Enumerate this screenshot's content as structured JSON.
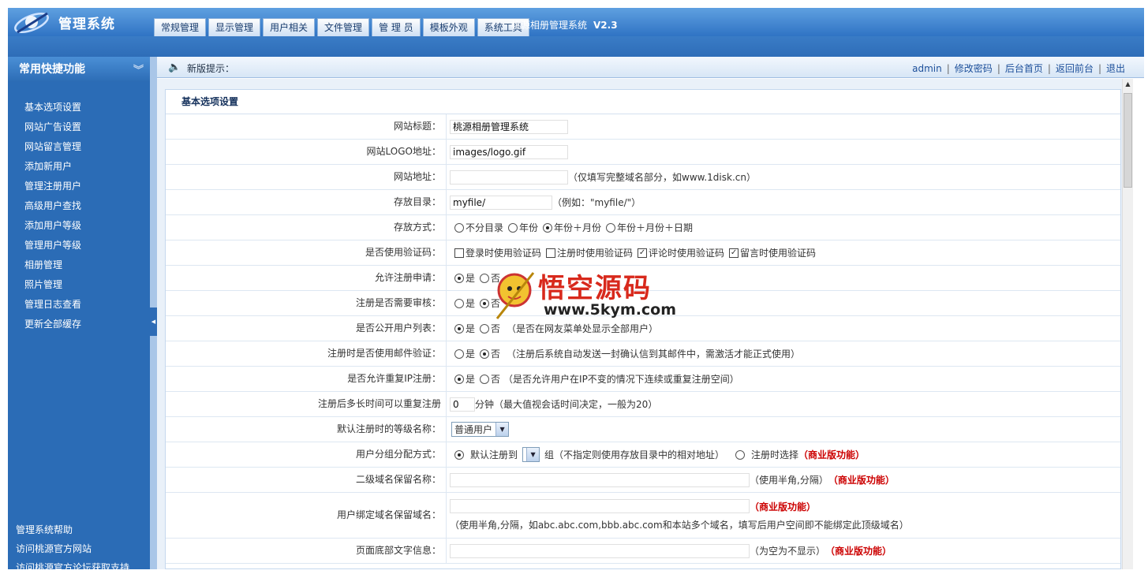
{
  "app": {
    "title": "管理系统",
    "system_name": "桃源相册管理系统",
    "version": "V2.3"
  },
  "tabs": [
    "常规管理",
    "显示管理",
    "用户相关",
    "文件管理",
    "管 理 员",
    "模板外观",
    "系统工具"
  ],
  "sidebar": {
    "title": "常用快捷功能",
    "items": [
      "基本选项设置",
      "网站广告设置",
      "网站留言管理",
      "添加新用户",
      "管理注册用户",
      "高级用户查找",
      "添加用户等级",
      "管理用户等级",
      "相册管理",
      "照片管理",
      "管理日志查看",
      "更新全部缓存"
    ],
    "bottom": [
      "管理系统帮助",
      "访问桃源官方网站",
      "访问桃源官方论坛获取支持"
    ]
  },
  "notice": {
    "label": "新版提示："
  },
  "toplinks": [
    "admin",
    "修改密码",
    "后台首页",
    "返回前台",
    "退出"
  ],
  "panel": {
    "title": "基本选项设置"
  },
  "form": {
    "site_title": {
      "label": "网站标题：",
      "value": "桃源相册管理系统"
    },
    "site_logo": {
      "label": "网站LOGO地址：",
      "value": "images/logo.gif"
    },
    "site_url": {
      "label": "网站地址：",
      "value": "",
      "hint": "（仅填写完整域名部分，如www.1disk.cn）"
    },
    "store_dir": {
      "label": "存放目录：",
      "value": "myfile/",
      "hint": "（例如：\"myfile/\"）"
    },
    "store_mode": {
      "label": "存放方式：",
      "options": [
        "不分目录",
        "年份",
        "年份＋月份",
        "年份＋月份＋日期"
      ],
      "selected": 2
    },
    "captcha": {
      "label": "是否使用验证码：",
      "options": [
        "登录时使用验证码",
        "注册时使用验证码",
        "评论时使用验证码",
        "留言时使用验证码"
      ],
      "checked": [
        false,
        false,
        true,
        true
      ]
    },
    "allow_reg": {
      "label": "允许注册申请：",
      "options": [
        "是",
        "否"
      ],
      "selected": 0
    },
    "reg_audit": {
      "label": "注册是否需要审核：",
      "options": [
        "是",
        "否"
      ],
      "selected": 1
    },
    "public_list": {
      "label": "是否公开用户列表：",
      "options": [
        "是",
        "否"
      ],
      "selected": 0,
      "hint": "（是否在网友菜单处显示全部用户）"
    },
    "email_verify": {
      "label": "注册时是否使用邮件验证：",
      "options": [
        "是",
        "否"
      ],
      "selected": 1,
      "hint": "（注册后系统自动发送一封确认信到其邮件中，需激活才能正式使用）"
    },
    "dup_ip": {
      "label": "是否允许重复IP注册：",
      "options": [
        "是",
        "否"
      ],
      "selected": 0,
      "hint": "（是否允许用户在IP不变的情况下连续或重复注册空间）"
    },
    "reg_interval": {
      "label": "注册后多长时间可以重复注册",
      "value": "0",
      "unit": "分钟",
      "hint": "（最大值视会话时间决定，一般为20）"
    },
    "default_level": {
      "label": "默认注册时的等级名称：",
      "value": "普通用户"
    },
    "group_assign": {
      "label": "用户分组分配方式：",
      "opt1": "默认注册到",
      "group_suffix": "组（不指定则使用存放目录中的相对地址）",
      "opt2": "注册时选择",
      "biz": "（商业版功能）"
    },
    "subdomain_reserved": {
      "label": "二级域名保留名称：",
      "value": "",
      "hint": "（使用半角,分隔）",
      "biz": "（商业版功能）"
    },
    "bind_domain_reserved": {
      "label": "用户绑定域名保留域名：",
      "value": "",
      "biz": "（商业版功能）",
      "hint": "（使用半角,分隔，如abc.abc.com,bbb.abc.com和本站多个域名，填写后用户空间即不能绑定此顶级域名）"
    },
    "footer_text": {
      "label": "页面底部文字信息：",
      "value": "",
      "hint": "（为空为不显示）",
      "biz": "（商业版功能）"
    }
  },
  "watermark": {
    "title": "悟空源码",
    "url": "www.5kym.com"
  },
  "colors": {
    "header": "#2f73c4",
    "sidebar": "#2b6cb6",
    "accent_red": "#cc0000"
  }
}
